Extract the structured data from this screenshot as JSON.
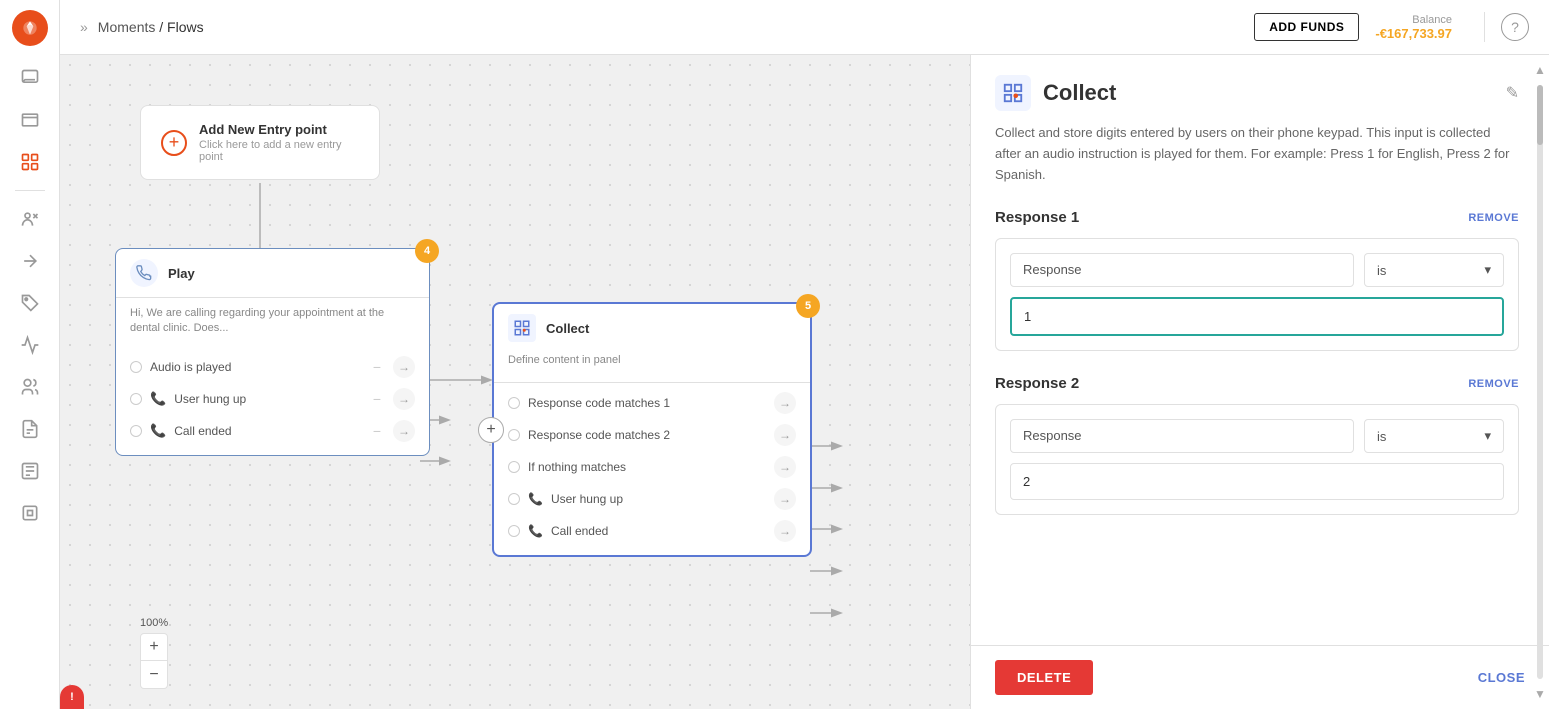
{
  "topbar": {
    "chevron_label": "»",
    "breadcrumb_parent": "Moments",
    "breadcrumb_separator": " / ",
    "breadcrumb_current": "Flows",
    "add_funds_label": "ADD FUNDS",
    "balance_label": "Balance",
    "balance_value": "-€167,733.97",
    "help_label": "?"
  },
  "sidebar": {
    "items": [
      {
        "id": "logo",
        "icon": "logo-icon"
      },
      {
        "id": "chat",
        "icon": "chat-icon"
      },
      {
        "id": "inbox",
        "icon": "inbox-icon"
      },
      {
        "id": "flows",
        "icon": "flows-icon",
        "active": true
      },
      {
        "id": "contacts",
        "icon": "contacts-icon"
      },
      {
        "id": "broadcast",
        "icon": "broadcast-icon"
      },
      {
        "id": "tags",
        "icon": "tags-icon"
      },
      {
        "id": "analytics",
        "icon": "analytics-icon"
      },
      {
        "id": "audience",
        "icon": "audience-icon"
      },
      {
        "id": "notes",
        "icon": "notes-icon"
      },
      {
        "id": "rules",
        "icon": "rules-icon"
      },
      {
        "id": "settings",
        "icon": "settings-icon"
      }
    ]
  },
  "canvas": {
    "entry_node": {
      "plus_label": "+",
      "title": "Add New Entry point",
      "subtitle": "Click here to add a new entry point"
    },
    "play_node": {
      "badge": "4",
      "title": "Play",
      "body": "Hi, We are calling regarding your appointment at the dental clinic. Does...",
      "outputs": [
        {
          "label": "Audio is played",
          "type": "default"
        },
        {
          "label": "User hung up",
          "type": "phone"
        },
        {
          "label": "Call ended",
          "type": "phone"
        }
      ]
    },
    "collect_node": {
      "badge": "5",
      "title": "Collect",
      "body": "Define content in panel",
      "outputs": [
        {
          "label": "Response code matches 1"
        },
        {
          "label": "Response code matches 2"
        },
        {
          "label": "If nothing matches"
        },
        {
          "label": "User hung up",
          "type": "phone"
        },
        {
          "label": "Call ended",
          "type": "phone"
        }
      ]
    }
  },
  "zoom": {
    "level": "100%",
    "plus_label": "+",
    "minus_label": "−"
  },
  "panel": {
    "icon_label": "grid-icon",
    "title": "Collect",
    "edit_icon": "✎",
    "description": "Collect and store digits entered by users on their phone keypad. This input is collected after an audio instruction is played for them. For example: Press 1 for English, Press 2 for Spanish.",
    "response1": {
      "title": "Response 1",
      "remove_label": "REMOVE",
      "field_label": "Response",
      "operator_label": "is",
      "value": "1"
    },
    "response2": {
      "title": "Response 2",
      "remove_label": "REMOVE",
      "field_label": "Response",
      "operator_label": "is",
      "value": "2"
    },
    "delete_label": "DELETE",
    "close_label": "CLOSE"
  }
}
